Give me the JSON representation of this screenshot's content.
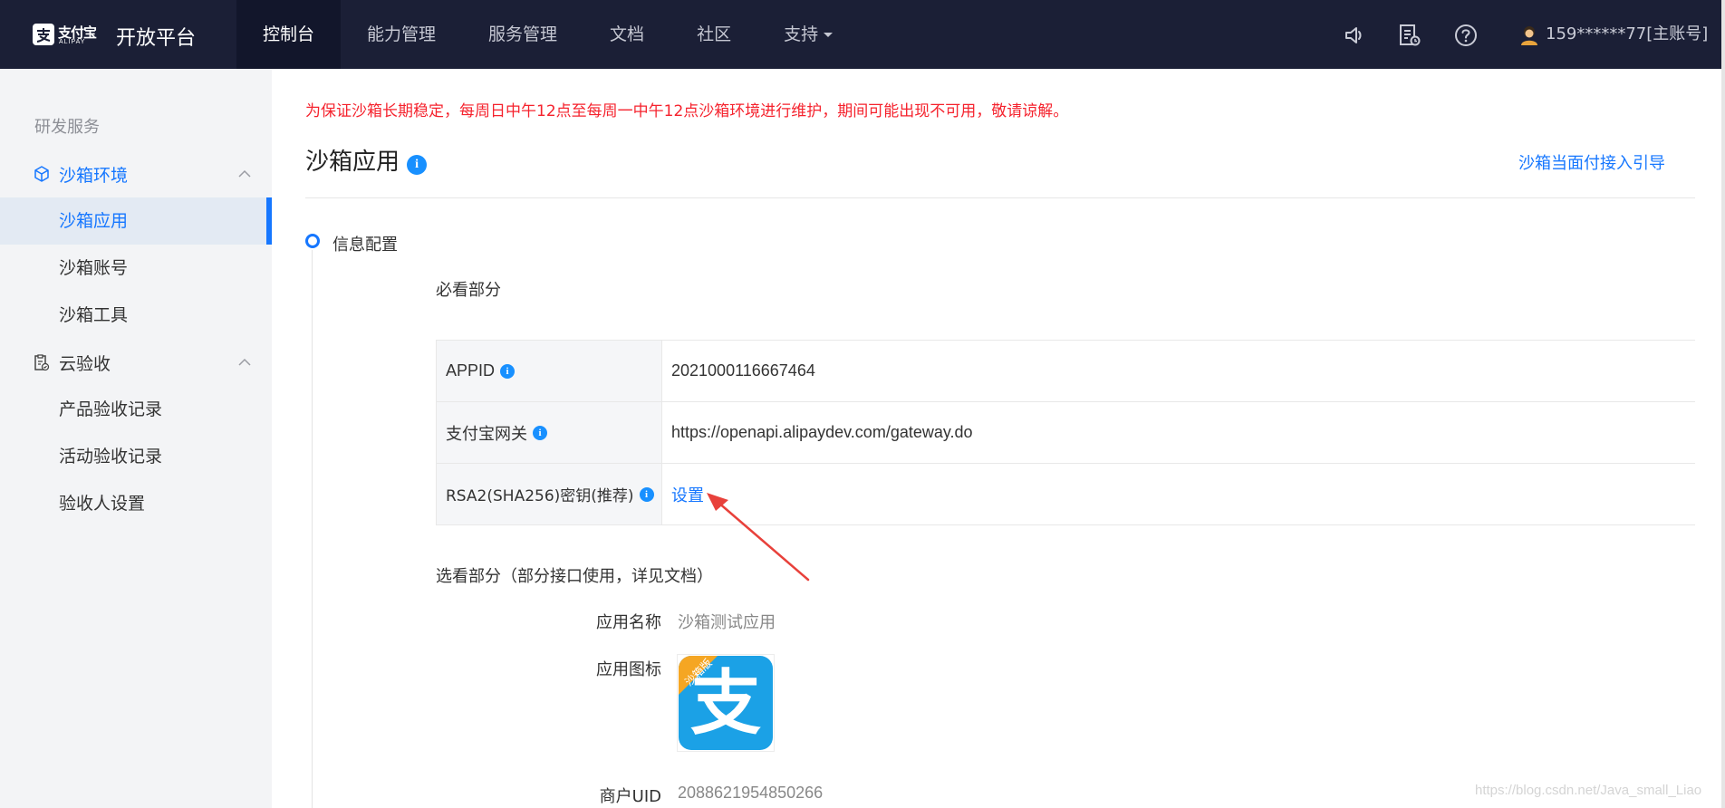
{
  "brand": {
    "logo_text": "支付宝",
    "logo_sub": "ALIPAY",
    "title": "开放平台"
  },
  "nav": {
    "items": [
      "控制台",
      "能力管理",
      "服务管理",
      "文档",
      "社区",
      "支持"
    ],
    "active": "控制台"
  },
  "header_icons": [
    "speaker-icon",
    "notes-icon",
    "help-icon"
  ],
  "user": {
    "name": "159******77[主账号]"
  },
  "sidebar": {
    "section": "研发服务",
    "groups": [
      {
        "label": "沙箱环境",
        "items": [
          "沙箱应用",
          "沙箱账号",
          "沙箱工具"
        ]
      },
      {
        "label": "云验收",
        "items": [
          "产品验收记录",
          "活动验收记录",
          "验收人设置"
        ]
      }
    ],
    "active_item": "沙箱应用"
  },
  "main": {
    "notice": "为保证沙箱长期稳定，每周日中午12点至每周一中午12点沙箱环境进行维护，期间可能出现不可用，敬请谅解。",
    "title": "沙箱应用",
    "guide_link": "沙箱当面付接入引导",
    "step_title": "信息配置",
    "required_heading": "必看部分",
    "required_rows": [
      {
        "key": "APPID",
        "value": "2021000116667464"
      },
      {
        "key": "支付宝网关",
        "value": "https://openapi.alipaydev.com/gateway.do"
      },
      {
        "key": "RSA2(SHA256)密钥(推荐)",
        "value": "设置"
      }
    ],
    "optional_heading": "选看部分（部分接口使用，详见文档）",
    "app_name_label": "应用名称",
    "app_name_value": "沙箱测试应用",
    "app_icon_label": "应用图标",
    "app_icon_badge": "沙箱版",
    "app_icon_glyph": "支",
    "merchant_uid_label": "商户UID",
    "merchant_uid_value": "2088621954850266"
  },
  "watermark": "https://blog.csdn.net/Java_small_Liao",
  "colors": {
    "topbar": "#1b1f36",
    "accent": "#1677ff",
    "notice": "#f5222d",
    "alipay_blue": "#1ba1e6",
    "badge_orange": "#f5a623",
    "annotation_arrow": "#e8413b"
  }
}
